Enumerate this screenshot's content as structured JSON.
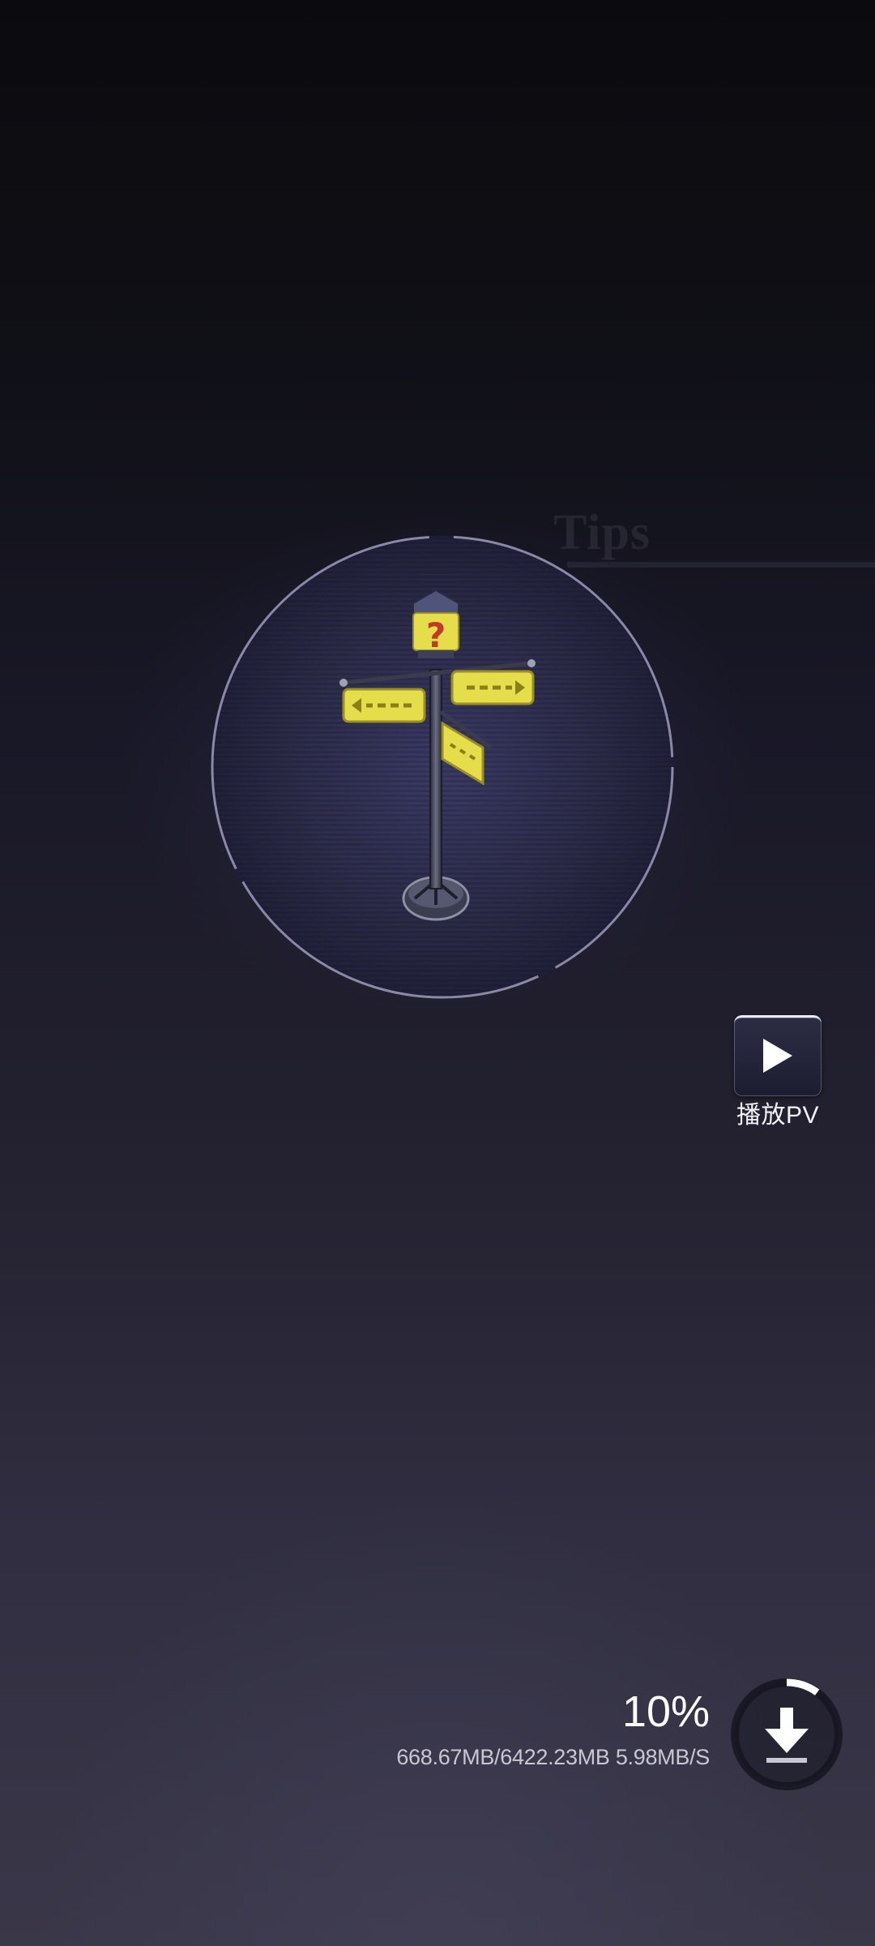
{
  "tips": {
    "heading": "Tips"
  },
  "illustration": {
    "icon": "signpost-question-icon",
    "accent_color": "#e6dd4a"
  },
  "pv": {
    "label": "播放PV",
    "icon": "play-icon"
  },
  "download": {
    "percent_text": "10%",
    "progress": 0.1,
    "stats_text": "668.67MB/6422.23MB 5.98MB/S",
    "icon": "download-icon"
  }
}
